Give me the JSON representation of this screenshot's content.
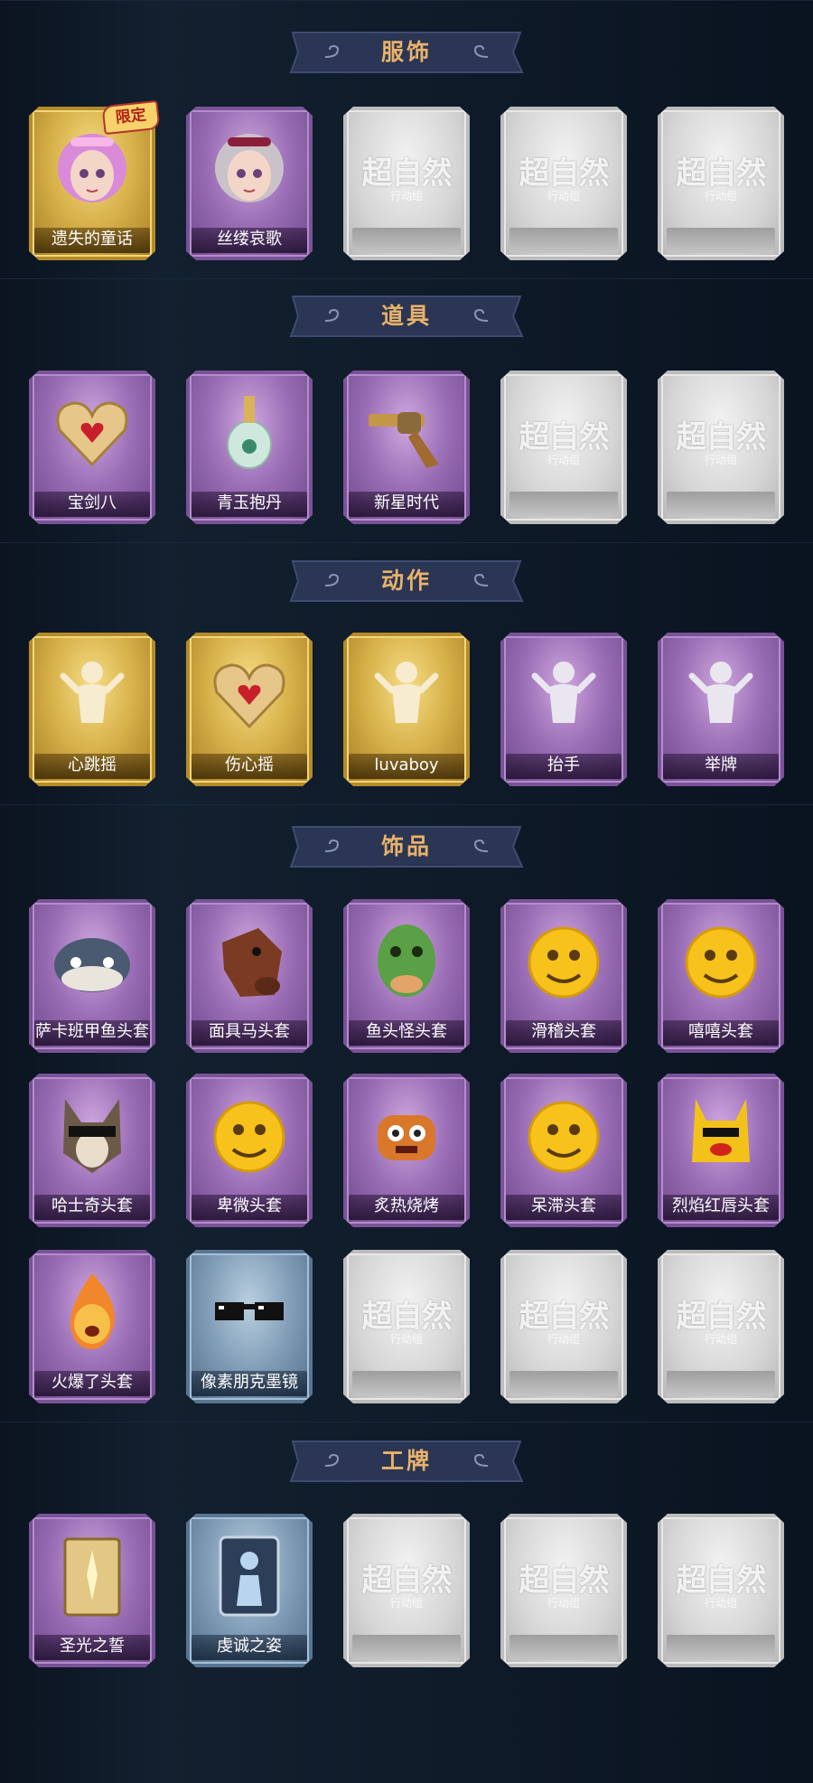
{
  "empty_card": {
    "title": "超自然",
    "subtitle": "行动组"
  },
  "sections": [
    {
      "title": "服饰",
      "items": [
        {
          "label": "遗失的童话",
          "rarity": "gold",
          "icon": "pink-hair-girl-portrait",
          "badge": "限定"
        },
        {
          "label": "丝缕哀歌",
          "rarity": "purple",
          "icon": "gothic-doll-girl-portrait"
        },
        {
          "label": "",
          "rarity": "empty"
        },
        {
          "label": "",
          "rarity": "empty"
        },
        {
          "label": "",
          "rarity": "empty"
        }
      ]
    },
    {
      "title": "道具",
      "items": [
        {
          "label": "宝剑八",
          "rarity": "purple",
          "icon": "heart-locket-icon"
        },
        {
          "label": "青玉抱丹",
          "rarity": "purple",
          "icon": "jade-bottle-icon"
        },
        {
          "label": "新星时代",
          "rarity": "purple",
          "icon": "revolver-icon"
        },
        {
          "label": "",
          "rarity": "empty"
        },
        {
          "label": "",
          "rarity": "empty"
        }
      ]
    },
    {
      "title": "动作",
      "items": [
        {
          "label": "心跳摇",
          "rarity": "gold",
          "icon": "dance-emote-icon"
        },
        {
          "label": "伤心摇",
          "rarity": "gold",
          "icon": "heart-hands-emote-icon"
        },
        {
          "label": "luvaboy",
          "rarity": "gold",
          "icon": "shy-emote-icon"
        },
        {
          "label": "抬手",
          "rarity": "purple",
          "icon": "raise-hand-emote-icon"
        },
        {
          "label": "举牌",
          "rarity": "purple",
          "icon": "hold-sign-emote-icon"
        }
      ]
    },
    {
      "title": "饰品",
      "items": [
        {
          "label": "萨卡班甲鱼头套",
          "rarity": "purple",
          "icon": "fish-head-mask-icon"
        },
        {
          "label": "面具马头套",
          "rarity": "purple",
          "icon": "horse-mask-icon"
        },
        {
          "label": "鱼头怪头套",
          "rarity": "purple",
          "icon": "green-fish-mask-icon"
        },
        {
          "label": "滑稽头套",
          "rarity": "purple",
          "icon": "smirk-emoji-mask-icon"
        },
        {
          "label": "嘻嘻头套",
          "rarity": "purple",
          "icon": "grin-emoji-mask-icon"
        },
        {
          "label": "哈士奇头套",
          "rarity": "purple",
          "icon": "husky-mask-icon"
        },
        {
          "label": "卑微头套",
          "rarity": "purple",
          "icon": "sad-emoji-mask-icon"
        },
        {
          "label": "炙热烧烤",
          "rarity": "purple",
          "icon": "bbq-meat-mask-icon"
        },
        {
          "label": "呆滞头套",
          "rarity": "purple",
          "icon": "dazed-emoji-mask-icon"
        },
        {
          "label": "烈焰红唇头套",
          "rarity": "purple",
          "icon": "yellow-lips-mask-icon"
        },
        {
          "label": "火爆了头套",
          "rarity": "purple",
          "icon": "fire-mask-icon"
        },
        {
          "label": "像素朋克墨镜",
          "rarity": "blue",
          "icon": "pixel-sunglasses-icon"
        },
        {
          "label": "",
          "rarity": "empty"
        },
        {
          "label": "",
          "rarity": "empty"
        },
        {
          "label": "",
          "rarity": "empty"
        }
      ]
    },
    {
      "title": "工牌",
      "items": [
        {
          "label": "圣光之誓",
          "rarity": "purple",
          "icon": "holy-light-badge-icon"
        },
        {
          "label": "虔诚之姿",
          "rarity": "blue",
          "icon": "silhouette-card-icon"
        },
        {
          "label": "",
          "rarity": "empty"
        },
        {
          "label": "",
          "rarity": "empty"
        },
        {
          "label": "",
          "rarity": "empty"
        }
      ]
    }
  ]
}
